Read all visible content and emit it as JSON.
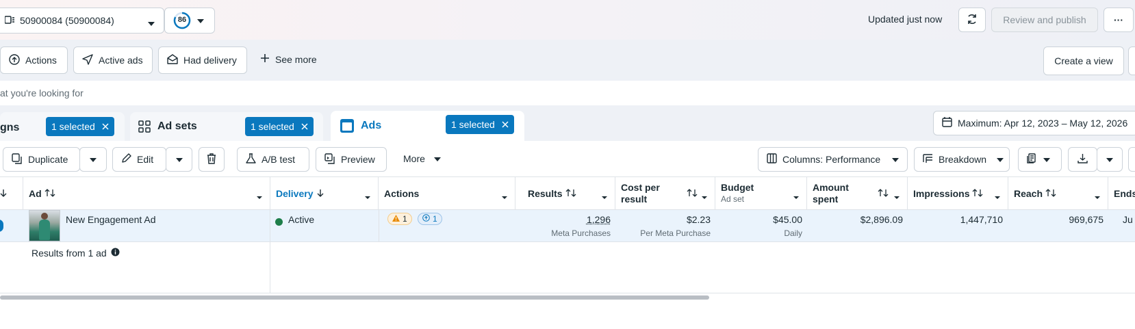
{
  "topbar": {
    "account_label": "50900084 (50900084)",
    "score": "86",
    "updated_text": "Updated just now",
    "review_publish_label": "Review and publish",
    "more_label": "···"
  },
  "filters": {
    "actions_label": "Actions",
    "active_ads_label": "Active ads",
    "had_delivery_label": "Had delivery",
    "see_more_label": "See more",
    "create_view_label": "Create a view"
  },
  "search": {
    "placeholder_text": "at you're looking for"
  },
  "tabs": {
    "campaigns_label": "gns",
    "adsets_label": "Ad sets",
    "ads_label": "Ads",
    "selected_label": "1 selected"
  },
  "date_range": "Maximum: Apr 12, 2023 – May 12, 2026",
  "toolbar": {
    "duplicate_label": "Duplicate",
    "edit_label": "Edit",
    "ab_test_label": "A/B test",
    "preview_label": "Preview",
    "more_label": "More",
    "columns_label": "Columns: Performance",
    "breakdown_label": "Breakdown"
  },
  "columns": {
    "ad": "Ad",
    "delivery": "Delivery",
    "actions": "Actions",
    "results": "Results",
    "cost_per_result_1": "Cost per",
    "cost_per_result_2": "result",
    "budget": "Budget",
    "budget_sub": "Ad set",
    "amount_spent_1": "Amount",
    "amount_spent_2": "spent",
    "impressions": "Impressions",
    "reach": "Reach",
    "ends": "Ends"
  },
  "row": {
    "ad_name": "New Engagement Ad",
    "delivery": "Active",
    "warnings_count": "1",
    "actions_count": "1",
    "results": "1,296",
    "results_sub": "Meta Purchases",
    "cost_per_result": "$2.23",
    "cost_sub": "Per Meta Purchase",
    "budget": "$45.00",
    "budget_sub": "Daily",
    "amount_spent": "$2,896.09",
    "impressions": "1,447,710",
    "reach": "969,675",
    "ends": "Ju"
  },
  "summary": {
    "results_from": "Results from 1 ad"
  },
  "colors": {
    "accent": "#0a78be",
    "active_green": "#1e7e4a",
    "warning": "#f59e0b"
  }
}
